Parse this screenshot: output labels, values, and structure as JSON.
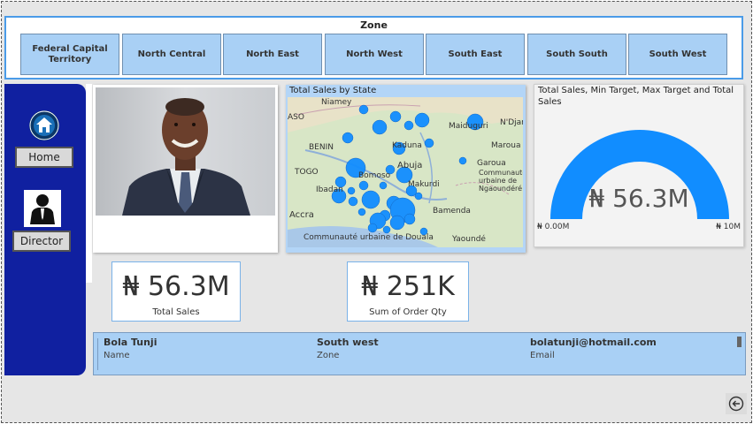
{
  "zone": {
    "title": "Zone",
    "options": [
      "Federal Capital Territory",
      "North Central",
      "North East",
      "North West",
      "South East",
      "South South",
      "South West"
    ]
  },
  "sidebar": {
    "home_label": "Home",
    "director_label": "Director"
  },
  "map": {
    "title": "Total Sales by State",
    "labels": [
      "Niamey",
      "N'Djar",
      "Maiduguri",
      "Kaduna",
      "Maroua",
      "BENIN",
      "Abuja",
      "Garoua",
      "TOGO",
      "Communauté urbaine de Ngaoundéré",
      "Makurdi",
      "Ibadan",
      "Accra",
      "Bamenda",
      "Communauté urbaine de Douala",
      "Yaoundé",
      "ASO",
      "Bomoso"
    ]
  },
  "gauge": {
    "title": "Total Sales, Min Target, Max Target and Total Sales",
    "value": "₦ 56.3M",
    "min_label": "₦ 0.00M",
    "max_label": "₦ 10M",
    "color": "#118dff"
  },
  "kpis": [
    {
      "value": "₦ 56.3M",
      "label": "Total Sales"
    },
    {
      "value": "₦ 251K",
      "label": "Sum of Order Qty"
    }
  ],
  "director": {
    "name": "Bola Tunji",
    "name_label": "Name",
    "zone": "South west",
    "zone_label": "Zone",
    "email": "bolatunji@hotmail.com",
    "email_label": "Email"
  },
  "colors": {
    "sidebar": "#1020a0",
    "slicer": "#a9d0f5",
    "accent": "#118dff"
  }
}
